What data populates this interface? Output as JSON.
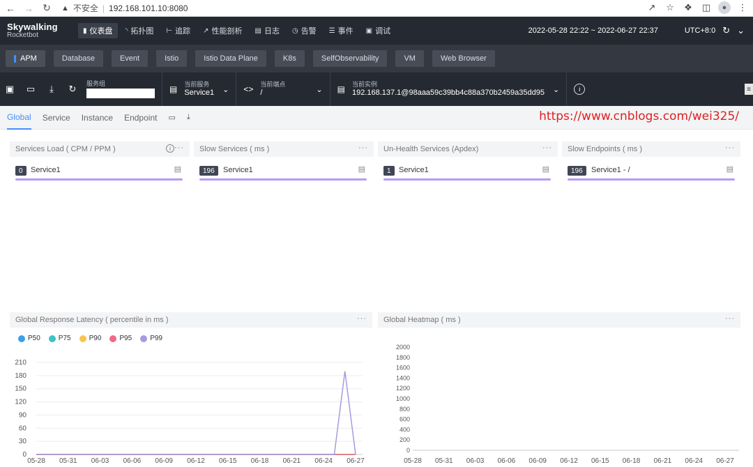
{
  "browser": {
    "insecure_label": "不安全",
    "url": "192.168.101.10:8080"
  },
  "topnav": {
    "logo_line1": "Skywalking",
    "logo_line2": "Rocketbot",
    "menu": [
      {
        "label": "仪表盘",
        "icon": "dashboard-icon",
        "active": true
      },
      {
        "label": "拓扑图",
        "icon": "topology-icon",
        "active": false
      },
      {
        "label": "追踪",
        "icon": "trace-icon",
        "active": false
      },
      {
        "label": "性能剖析",
        "icon": "profile-icon",
        "active": false
      },
      {
        "label": "日志",
        "icon": "log-icon",
        "active": false
      },
      {
        "label": "告警",
        "icon": "alarm-icon",
        "active": false
      },
      {
        "label": "事件",
        "icon": "event-icon",
        "active": false
      },
      {
        "label": "调试",
        "icon": "debug-icon",
        "active": false
      }
    ],
    "time_range": "2022-05-28 22:22 ~ 2022-06-27 22:37",
    "timezone": "UTC+8:0"
  },
  "categories": [
    {
      "label": "APM",
      "active": true
    },
    {
      "label": "Database",
      "active": false
    },
    {
      "label": "Event",
      "active": false
    },
    {
      "label": "Istio",
      "active": false
    },
    {
      "label": "Istio Data Plane",
      "active": false
    },
    {
      "label": "K8s",
      "active": false
    },
    {
      "label": "SelfObservability",
      "active": false
    },
    {
      "label": "VM",
      "active": false
    },
    {
      "label": "Web Browser",
      "active": false
    }
  ],
  "toolbar": {
    "group_label": "服务组",
    "group_value": "",
    "service_label": "当前服务",
    "service_value": "Service1",
    "endpoint_label": "当前端点",
    "endpoint_value": "/",
    "instance_label": "当前实例",
    "instance_value": "192.168.137.1@98aaa59c39bb4c88a370b2459a35dd95"
  },
  "subtabs": [
    {
      "label": "Global",
      "active": true
    },
    {
      "label": "Service",
      "active": false
    },
    {
      "label": "Instance",
      "active": false
    },
    {
      "label": "Endpoint",
      "active": false
    }
  ],
  "watermark": "https://www.cnblogs.com/wei325/",
  "panels": {
    "services_load": {
      "title": "Services Load ( CPM / PPM )",
      "items": [
        {
          "badge": "0",
          "name": "Service1"
        }
      ]
    },
    "slow_services": {
      "title": "Slow Services ( ms )",
      "items": [
        {
          "badge": "196",
          "name": "Service1"
        }
      ]
    },
    "unhealth_services": {
      "title": "Un-Health Services (Apdex)",
      "items": [
        {
          "badge": "1",
          "name": "Service1"
        }
      ]
    },
    "slow_endpoints": {
      "title": "Slow Endpoints ( ms )",
      "items": [
        {
          "badge": "196",
          "name": "Service1 - /"
        }
      ]
    },
    "latency_title": "Global Response Latency ( percentile in ms )",
    "heatmap_title": "Global Heatmap ( ms )"
  },
  "chart_data": [
    {
      "type": "line",
      "title": "Global Response Latency ( percentile in ms )",
      "x": [
        "05-28",
        "05-31",
        "06-03",
        "06-06",
        "06-09",
        "06-12",
        "06-15",
        "06-18",
        "06-21",
        "06-24",
        "06-27"
      ],
      "ylim": [
        0,
        210
      ],
      "yticks": [
        0,
        30,
        60,
        90,
        120,
        150,
        180,
        210
      ],
      "legend_position": "top-left",
      "series": [
        {
          "name": "P50",
          "color": "#3ba1e8",
          "points": [
            [
              "05-28",
              0
            ],
            [
              "06-25",
              0
            ],
            [
              "06-26",
              0
            ],
            [
              "06-27",
              0
            ]
          ]
        },
        {
          "name": "P75",
          "color": "#3fc2c2",
          "points": [
            [
              "05-28",
              0
            ],
            [
              "06-25",
              0
            ],
            [
              "06-26",
              0
            ],
            [
              "06-27",
              0
            ]
          ]
        },
        {
          "name": "P90",
          "color": "#f8c54c",
          "points": [
            [
              "05-28",
              0
            ],
            [
              "06-25",
              0
            ],
            [
              "06-26",
              0
            ],
            [
              "06-27",
              0
            ]
          ]
        },
        {
          "name": "P95",
          "color": "#f06a85",
          "points": [
            [
              "05-28",
              0
            ],
            [
              "06-25",
              0
            ],
            [
              "06-26",
              0
            ],
            [
              "06-27",
              0
            ]
          ]
        },
        {
          "name": "P99",
          "color": "#a49be0",
          "points": [
            [
              "05-28",
              0
            ],
            [
              "06-25",
              0
            ],
            [
              "06-26",
              190
            ],
            [
              "06-27",
              0
            ]
          ]
        }
      ]
    },
    {
      "type": "heatmap",
      "title": "Global Heatmap ( ms )",
      "x": [
        "05-28",
        "05-31",
        "06-03",
        "06-06",
        "06-09",
        "06-12",
        "06-15",
        "06-18",
        "06-21",
        "06-24",
        "06-27"
      ],
      "ylim": [
        0,
        2000
      ],
      "yticks": [
        0,
        200,
        400,
        600,
        800,
        1000,
        1200,
        1400,
        1600,
        1800,
        2000
      ],
      "values": []
    }
  ]
}
